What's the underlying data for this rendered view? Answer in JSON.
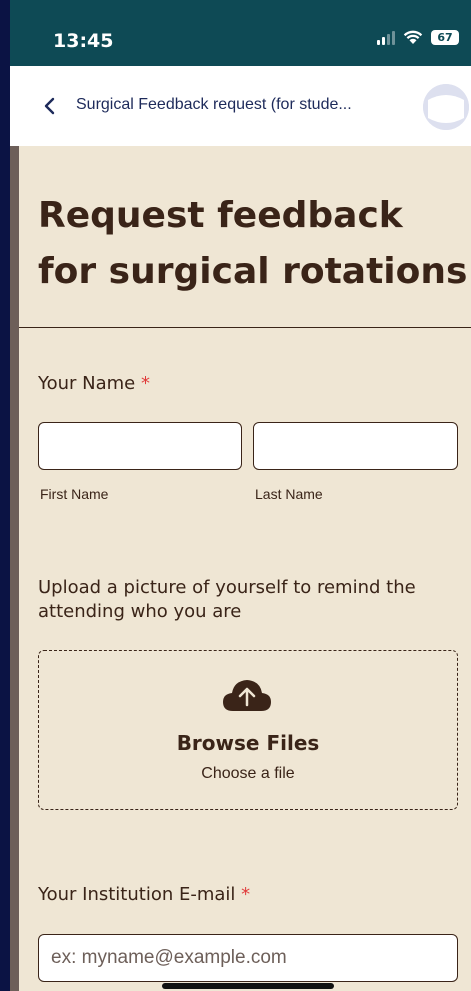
{
  "status_bar": {
    "time": "13:45",
    "battery": "67"
  },
  "nav": {
    "title": "Surgical Feedback request (for stude..."
  },
  "form": {
    "title": "Request feedback for surgical rotations",
    "name_field": {
      "label": "Your Name",
      "required_mark": "*",
      "first_label": "First Name",
      "last_label": "Last Name",
      "first_value": "",
      "last_value": ""
    },
    "upload": {
      "label": "Upload a picture of yourself to remind the attending who you are",
      "button_title": "Browse Files",
      "button_sub": "Choose a file"
    },
    "email": {
      "label": "Your Institution E-mail",
      "required_mark": "*",
      "placeholder": "ex: myname@example.com"
    }
  },
  "colors": {
    "accent_status": "#0e4a55",
    "form_background": "#efe6d4",
    "text_dark": "#3a2418",
    "required": "#e03a3a"
  }
}
